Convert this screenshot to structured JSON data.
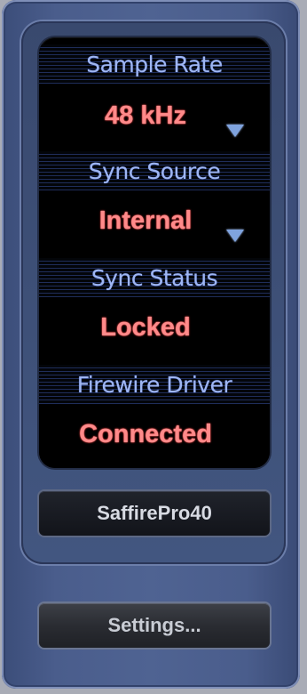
{
  "panel": {
    "sections": [
      {
        "header": "Sample Rate",
        "value": "48 kHz",
        "has_dropdown": true
      },
      {
        "header": "Sync Source",
        "value": "Internal",
        "has_dropdown": true
      },
      {
        "header": "Sync Status",
        "value": "Locked",
        "has_dropdown": false
      },
      {
        "header": "Firewire Driver",
        "value": "Connected",
        "has_dropdown": false
      }
    ],
    "device_name": "SaffirePro40",
    "settings_label": "Settings..."
  },
  "colors": {
    "header_text": "#9fb6f2",
    "value_text": "#ff8a8a",
    "dropdown_arrow": "#7fa3de",
    "frame": "#4f6392"
  }
}
